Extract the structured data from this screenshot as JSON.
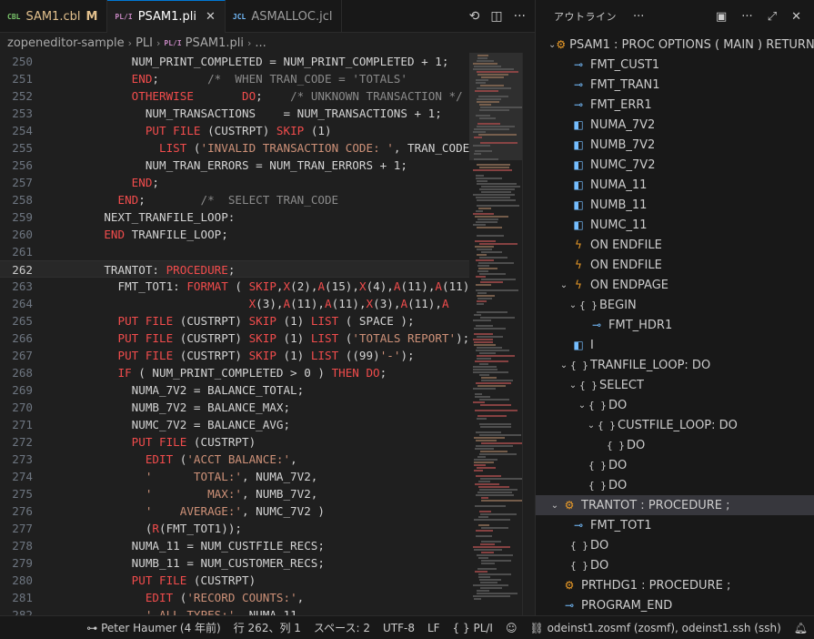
{
  "tabs": [
    {
      "type_label": "CBL",
      "name": "SAM1.cbl",
      "modified": "M"
    },
    {
      "type_label": "PL/I",
      "name": "PSAM1.pli"
    },
    {
      "type_label": "JCL",
      "name": "ASMALLOC.jcl"
    }
  ],
  "tab_actions": {
    "history_icon": "history-icon",
    "split_icon": "split-editor-icon",
    "more_icon": "more-icon"
  },
  "breadcrumb": {
    "root": "zopeneditor-sample",
    "folder": "PLI",
    "file_type": "PL/I",
    "file": "PSAM1.pli",
    "tail": "..."
  },
  "editor": {
    "current_line": "262",
    "lines": [
      {
        "n": "250",
        "tokens": [
          [
            "plain",
            "        NUM_PRINT_COMPLETED = NUM_PRINT_COMPLETED + 1;"
          ]
        ]
      },
      {
        "n": "251",
        "tokens": [
          [
            "plain",
            "        "
          ],
          [
            "kw",
            "END"
          ],
          [
            "plain",
            ";       "
          ],
          [
            "cm",
            "/*  WHEN TRAN_CODE = 'TOTALS'"
          ]
        ]
      },
      {
        "n": "252",
        "tokens": [
          [
            "plain",
            "        "
          ],
          [
            "kw",
            "OTHERWISE"
          ],
          [
            "plain",
            "       "
          ],
          [
            "kw",
            "DO"
          ],
          [
            "plain",
            ";    "
          ],
          [
            "cm",
            "/* UNKNOWN TRANSACTION */"
          ]
        ]
      },
      {
        "n": "253",
        "tokens": [
          [
            "plain",
            "          NUM_TRANSACTIONS    = NUM_TRANSACTIONS + 1;"
          ]
        ]
      },
      {
        "n": "254",
        "tokens": [
          [
            "plain",
            "          "
          ],
          [
            "kw",
            "PUT FILE"
          ],
          [
            "plain",
            " ("
          ],
          [
            "plain",
            "CUSTRPT"
          ],
          [
            "plain",
            ") "
          ],
          [
            "kw",
            "SKIP"
          ],
          [
            "plain",
            " (1)"
          ]
        ]
      },
      {
        "n": "255",
        "tokens": [
          [
            "plain",
            "            "
          ],
          [
            "kw",
            "LIST"
          ],
          [
            "plain",
            " ("
          ],
          [
            "str",
            "'INVALID TRANSACTION CODE: '"
          ],
          [
            "plain",
            ", TRAN_CODE)"
          ]
        ]
      },
      {
        "n": "256",
        "tokens": [
          [
            "plain",
            "          NUM_TRAN_ERRORS = NUM_TRAN_ERRORS + 1;"
          ]
        ]
      },
      {
        "n": "257",
        "tokens": [
          [
            "plain",
            "        "
          ],
          [
            "kw",
            "END"
          ],
          [
            "plain",
            ";"
          ]
        ]
      },
      {
        "n": "258",
        "tokens": [
          [
            "plain",
            "      "
          ],
          [
            "kw",
            "END"
          ],
          [
            "plain",
            ";        "
          ],
          [
            "cm",
            "/*  SELECT TRAN_CODE                    */"
          ]
        ]
      },
      {
        "n": "259",
        "tokens": [
          [
            "plain",
            "    NEXT_TRANFILE_LOOP:"
          ]
        ]
      },
      {
        "n": "260",
        "tokens": [
          [
            "plain",
            "    "
          ],
          [
            "kw",
            "END"
          ],
          [
            "plain",
            " TRANFILE_LOOP;"
          ]
        ]
      },
      {
        "n": "261",
        "tokens": [
          [
            "plain",
            ""
          ]
        ]
      },
      {
        "n": "262",
        "tokens": [
          [
            "plain",
            "    TRANTOT: "
          ],
          [
            "kw",
            "PROCEDURE"
          ],
          [
            "plain",
            ";"
          ]
        ]
      },
      {
        "n": "263",
        "tokens": [
          [
            "plain",
            "      FMT_TOT1: "
          ],
          [
            "kw",
            "FORMAT"
          ],
          [
            "plain",
            " ( "
          ],
          [
            "kw",
            "SKIP"
          ],
          [
            "plain",
            ","
          ],
          [
            "kw",
            "X"
          ],
          [
            "plain",
            "(2),"
          ],
          [
            "kw",
            "A"
          ],
          [
            "plain",
            "(15),"
          ],
          [
            "kw",
            "X"
          ],
          [
            "plain",
            "(4),"
          ],
          [
            "kw",
            "A"
          ],
          [
            "plain",
            "(11),"
          ],
          [
            "kw",
            "A"
          ],
          [
            "plain",
            "(11),"
          ]
        ]
      },
      {
        "n": "264",
        "tokens": [
          [
            "plain",
            "                         "
          ],
          [
            "kw",
            "X"
          ],
          [
            "plain",
            "(3),"
          ],
          [
            "kw",
            "A"
          ],
          [
            "plain",
            "(11),"
          ],
          [
            "kw",
            "A"
          ],
          [
            "plain",
            "(11),"
          ],
          [
            "kw",
            "X"
          ],
          [
            "plain",
            "(3),"
          ],
          [
            "kw",
            "A"
          ],
          [
            "plain",
            "(11),"
          ],
          [
            "kw",
            "A"
          ]
        ]
      },
      {
        "n": "265",
        "tokens": [
          [
            "plain",
            "      "
          ],
          [
            "kw",
            "PUT FILE"
          ],
          [
            "plain",
            " (CUSTRPT) "
          ],
          [
            "kw",
            "SKIP"
          ],
          [
            "plain",
            " (1) "
          ],
          [
            "kw",
            "LIST"
          ],
          [
            "plain",
            " ( SPACE );"
          ]
        ]
      },
      {
        "n": "266",
        "tokens": [
          [
            "plain",
            "      "
          ],
          [
            "kw",
            "PUT FILE"
          ],
          [
            "plain",
            " (CUSTRPT) "
          ],
          [
            "kw",
            "SKIP"
          ],
          [
            "plain",
            " (1) "
          ],
          [
            "kw",
            "LIST"
          ],
          [
            "plain",
            " ("
          ],
          [
            "str",
            "'TOTALS REPORT'"
          ],
          [
            "plain",
            ");"
          ]
        ]
      },
      {
        "n": "267",
        "tokens": [
          [
            "plain",
            "      "
          ],
          [
            "kw",
            "PUT FILE"
          ],
          [
            "plain",
            " (CUSTRPT) "
          ],
          [
            "kw",
            "SKIP"
          ],
          [
            "plain",
            " (1) "
          ],
          [
            "kw",
            "LIST"
          ],
          [
            "plain",
            " ((99)"
          ],
          [
            "str",
            "'-'"
          ],
          [
            "plain",
            ");"
          ]
        ]
      },
      {
        "n": "268",
        "tokens": [
          [
            "plain",
            "      "
          ],
          [
            "kw",
            "IF"
          ],
          [
            "plain",
            " ( NUM_PRINT_COMPLETED > 0 ) "
          ],
          [
            "kw",
            "THEN DO"
          ],
          [
            "plain",
            ";"
          ]
        ]
      },
      {
        "n": "269",
        "tokens": [
          [
            "plain",
            "        NUMA_7V2 = BALANCE_TOTAL;"
          ]
        ]
      },
      {
        "n": "270",
        "tokens": [
          [
            "plain",
            "        NUMB_7V2 = BALANCE_MAX;"
          ]
        ]
      },
      {
        "n": "271",
        "tokens": [
          [
            "plain",
            "        NUMC_7V2 = BALANCE_AVG;"
          ]
        ]
      },
      {
        "n": "272",
        "tokens": [
          [
            "plain",
            "        "
          ],
          [
            "kw",
            "PUT FILE"
          ],
          [
            "plain",
            " (CUSTRPT)"
          ]
        ]
      },
      {
        "n": "273",
        "tokens": [
          [
            "plain",
            "          "
          ],
          [
            "kw",
            "EDIT"
          ],
          [
            "plain",
            " ("
          ],
          [
            "str",
            "'ACCT BALANCE:'"
          ],
          [
            "plain",
            ","
          ]
        ]
      },
      {
        "n": "274",
        "tokens": [
          [
            "plain",
            "          "
          ],
          [
            "str",
            "'      TOTAL:'"
          ],
          [
            "plain",
            ", NUMA_7V2,"
          ]
        ]
      },
      {
        "n": "275",
        "tokens": [
          [
            "plain",
            "          "
          ],
          [
            "str",
            "'        MAX:'"
          ],
          [
            "plain",
            ", NUMB_7V2,"
          ]
        ]
      },
      {
        "n": "276",
        "tokens": [
          [
            "plain",
            "          "
          ],
          [
            "str",
            "'    AVERAGE:'"
          ],
          [
            "plain",
            ", NUMC_7V2 )"
          ]
        ]
      },
      {
        "n": "277",
        "tokens": [
          [
            "plain",
            "          ("
          ],
          [
            "kw",
            "R"
          ],
          [
            "plain",
            "(FMT_TOT1));"
          ]
        ]
      },
      {
        "n": "278",
        "tokens": [
          [
            "plain",
            "        NUMA_11 = NUM_CUSTFILE_RECS;"
          ]
        ]
      },
      {
        "n": "279",
        "tokens": [
          [
            "plain",
            "        NUMB_11 = NUM_CUSTOMER_RECS;"
          ]
        ]
      },
      {
        "n": "280",
        "tokens": [
          [
            "plain",
            "        "
          ],
          [
            "kw",
            "PUT FILE"
          ],
          [
            "plain",
            " (CUSTRPT)"
          ]
        ]
      },
      {
        "n": "281",
        "tokens": [
          [
            "plain",
            "          "
          ],
          [
            "kw",
            "EDIT"
          ],
          [
            "plain",
            " ("
          ],
          [
            "str",
            "'RECORD COUNTS:'"
          ],
          [
            "plain",
            ","
          ]
        ]
      },
      {
        "n": "282",
        "tokens": [
          [
            "plain",
            "          "
          ],
          [
            "str",
            "' ALL TYPES:'"
          ],
          [
            "plain",
            ", NUMA_11,"
          ]
        ]
      }
    ]
  },
  "outline": {
    "title": "アウトライン",
    "items": [
      {
        "depth": 0,
        "chev": "v",
        "icon": "proc",
        "label": "PSAM1 : PROC OPTIONS ( MAIN ) RETURN..."
      },
      {
        "depth": 1,
        "chev": "",
        "icon": "field",
        "label": "FMT_CUST1"
      },
      {
        "depth": 1,
        "chev": "",
        "icon": "field",
        "label": "FMT_TRAN1"
      },
      {
        "depth": 1,
        "chev": "",
        "icon": "field",
        "label": "FMT_ERR1"
      },
      {
        "depth": 1,
        "chev": "",
        "icon": "var",
        "label": "NUMA_7V2"
      },
      {
        "depth": 1,
        "chev": "",
        "icon": "var",
        "label": "NUMB_7V2"
      },
      {
        "depth": 1,
        "chev": "",
        "icon": "var",
        "label": "NUMC_7V2"
      },
      {
        "depth": 1,
        "chev": "",
        "icon": "var",
        "label": "NUMA_11"
      },
      {
        "depth": 1,
        "chev": "",
        "icon": "var",
        "label": "NUMB_11"
      },
      {
        "depth": 1,
        "chev": "",
        "icon": "var",
        "label": "NUMC_11"
      },
      {
        "depth": 1,
        "chev": "",
        "icon": "event",
        "label": "ON ENDFILE"
      },
      {
        "depth": 1,
        "chev": "",
        "icon": "event",
        "label": "ON ENDFILE"
      },
      {
        "depth": 1,
        "chev": "v",
        "icon": "event",
        "label": "ON ENDPAGE"
      },
      {
        "depth": 2,
        "chev": "v",
        "icon": "ns",
        "label": "BEGIN"
      },
      {
        "depth": 3,
        "chev": "",
        "icon": "field",
        "label": "FMT_HDR1"
      },
      {
        "depth": 1,
        "chev": "",
        "icon": "var",
        "label": "I"
      },
      {
        "depth": 1,
        "chev": "v",
        "icon": "ns",
        "label": "TRANFILE_LOOP: DO"
      },
      {
        "depth": 2,
        "chev": "v",
        "icon": "ns",
        "label": "SELECT"
      },
      {
        "depth": 3,
        "chev": "v",
        "icon": "ns",
        "label": "DO"
      },
      {
        "depth": 4,
        "chev": "v",
        "icon": "ns",
        "label": "CUSTFILE_LOOP: DO"
      },
      {
        "depth": 5,
        "chev": "",
        "icon": "ns",
        "label": "DO"
      },
      {
        "depth": 3,
        "chev": "",
        "icon": "ns",
        "label": "DO"
      },
      {
        "depth": 3,
        "chev": "",
        "icon": "ns",
        "label": "DO"
      },
      {
        "depth": 0,
        "chev": "v",
        "icon": "proc",
        "label": "TRANTOT : PROCEDURE ;",
        "selected": true
      },
      {
        "depth": 1,
        "chev": "",
        "icon": "field",
        "label": "FMT_TOT1"
      },
      {
        "depth": 1,
        "chev": "",
        "icon": "ns",
        "label": "DO"
      },
      {
        "depth": 1,
        "chev": "",
        "icon": "ns",
        "label": "DO"
      },
      {
        "depth": 0,
        "chev": "",
        "icon": "proc",
        "label": "PRTHDG1 : PROCEDURE ;"
      },
      {
        "depth": 0,
        "chev": "",
        "icon": "field",
        "label": "PROGRAM_END"
      }
    ]
  },
  "statusbar": {
    "blame": "Peter Haumer (4 年前)",
    "position": "行 262、列 1",
    "spaces": "スペース: 2",
    "encoding": "UTF-8",
    "eol": "LF",
    "language": "PL/I",
    "remote": "odeinst1.zosmf (zosmf), odeinst1.ssh (ssh)"
  }
}
